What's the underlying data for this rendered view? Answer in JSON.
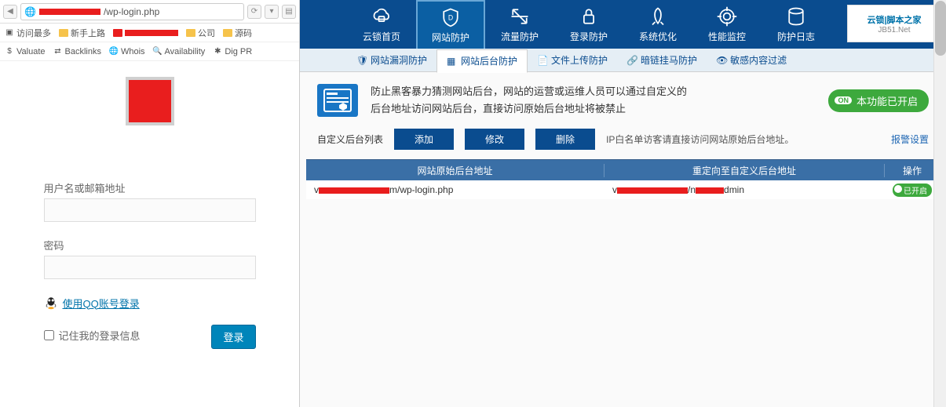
{
  "browser": {
    "url_suffix": "/wp-login.php",
    "bookmarks": {
      "most_visited": "访问最多",
      "newbie": "新手上路",
      "company": "公司",
      "source": "源码"
    },
    "tools": {
      "valuate": "Valuate",
      "backlinks": "Backlinks",
      "whois": "Whois",
      "availability": "Availability",
      "digpr": "Dig PR"
    }
  },
  "login": {
    "username_label": "用户名或邮箱地址",
    "password_label": "密码",
    "qq_login": "使用QQ账号登录",
    "remember": "记住我的登录信息",
    "submit": "登录"
  },
  "topnav": {
    "home": "云锁首页",
    "site": "网站防护",
    "traffic": "流量防护",
    "login": "登录防护",
    "system": "系统优化",
    "perf": "性能监控",
    "log": "防护日志"
  },
  "brand": {
    "l1": "云锁|脚本之家",
    "l2": "JB51.Net"
  },
  "subtabs": {
    "vuln": "网站漏洞防护",
    "backend": "网站后台防护",
    "upload": "文件上传防护",
    "darklink": "暗链挂马防护",
    "sensitive": "敏感内容过滤"
  },
  "desc": {
    "line1": "防止黑客暴力猜测网站后台，网站的运营或运维人员可以通过自定义的",
    "line2": "后台地址访问网站后台，直接访问原始后台地址将被禁止"
  },
  "feature_on": "本功能已开启",
  "feature_on_tag": "ON",
  "actions": {
    "list_label": "自定义后台列表",
    "add": "添加",
    "edit": "修改",
    "del": "删除",
    "whitelist_note": "IP白名单访客请直接访问网站原始后台地址。",
    "alarm": "报警设置"
  },
  "table": {
    "col_original": "网站原始后台地址",
    "col_redirect": "重定向至自定义后台地址",
    "col_action": "操作",
    "row1_orig_suffix": "m/wp-login.php",
    "row1_redir_mid": "/n",
    "row1_redir_suffix": "dmin",
    "toggle": "已开启"
  }
}
